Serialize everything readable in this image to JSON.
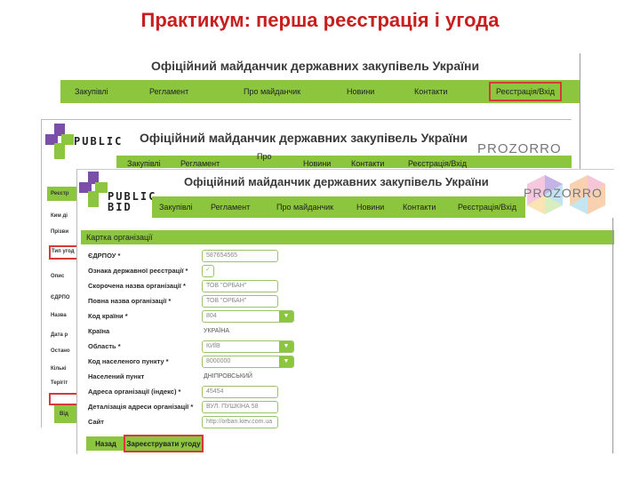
{
  "slide_title": "Практикум: перша реєстрація і угода",
  "site_heading": "Офіційний майданчик державних закупівель України",
  "nav": {
    "items": [
      "Закупівлі",
      "Регламент",
      "Про майданчик",
      "Новини",
      "Контакти",
      "Реєстрація/Вхід"
    ],
    "mid_items": [
      "Закупівлі",
      "Регламент",
      "Про",
      "Новини",
      "Контакти",
      "Реєстрація/Вхід"
    ]
  },
  "logo": {
    "line1": "PUBLIC",
    "line2": "BID",
    "partner": "PROZORRO",
    "mid_line2": "BID"
  },
  "back_layer": {
    "labels": [
      "Реєстр",
      "Ким ді",
      "Прізви",
      "Тип угод",
      "Опис",
      "ЄДРПО",
      "Назва",
      "Дата р",
      "Остано",
      "Кількі",
      "Терігіт",
      "Від"
    ]
  },
  "form": {
    "header": "Картка організації",
    "rows": [
      {
        "label": "ЄДРПОУ *",
        "value": "587654565",
        "kind": "field"
      },
      {
        "label": "Ознака державної реєстрації *",
        "value": "✓",
        "kind": "check"
      },
      {
        "label": "Скорочена назва організації *",
        "value": "ТОВ \"ОРБАН\"",
        "kind": "field"
      },
      {
        "label": "Повна назва організації *",
        "value": "ТОВ \"ОРБАН\"",
        "kind": "field"
      },
      {
        "label": "Код країни *",
        "value": "804",
        "kind": "select"
      },
      {
        "label": "Країна",
        "value": "УКРАЇНА",
        "kind": "plain"
      },
      {
        "label": "Область *",
        "value": "КИЇВ",
        "kind": "select"
      },
      {
        "label": "Код населеного пункту *",
        "value": "8000000",
        "kind": "select"
      },
      {
        "label": "Населений пункт",
        "value": "ДНІПРОВСЬКИЙ",
        "kind": "plain"
      },
      {
        "label": "Адреса організації (індекс) *",
        "value": "45454",
        "kind": "field"
      },
      {
        "label": "Деталізація адреси організації *",
        "value": "ВУЛ. ПУШКІНА 58",
        "kind": "field"
      },
      {
        "label": "Сайт",
        "value": "http://orban.kiev.com.ua",
        "kind": "field"
      }
    ],
    "back_button": "Назад",
    "submit_button": "Зареєструвати угоду"
  },
  "colors": {
    "accent": "#8cc63f",
    "highlight": "#d43a3a",
    "title": "#c81e1e"
  }
}
